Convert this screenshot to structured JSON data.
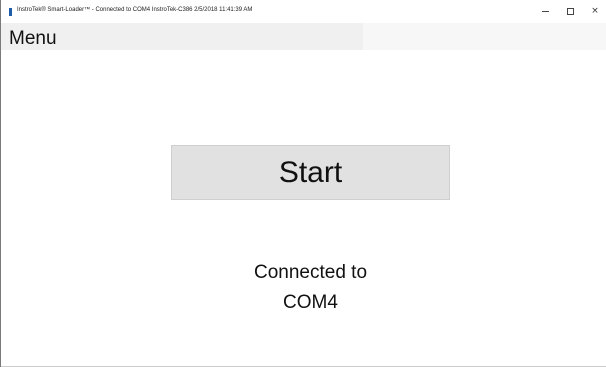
{
  "window": {
    "title": "InstroTek® Smart-Loader™  - Connected to COM4 InstroTek-C386 2/5/2018 11:41:39 AM",
    "icons": {
      "app": "app-icon",
      "minimize": "minimize-icon",
      "maximize": "maximize-icon",
      "close": "close-icon"
    },
    "close_glyph": "×"
  },
  "menubar": {
    "menu_label": "Menu"
  },
  "main": {
    "start_label": "Start",
    "status_line1": "Connected to",
    "status_line2": "COM4"
  },
  "colors": {
    "button_bg": "#e1e1e1",
    "menubar_bg": "#f7f7f7",
    "app_icon": "#1c5fa8"
  }
}
